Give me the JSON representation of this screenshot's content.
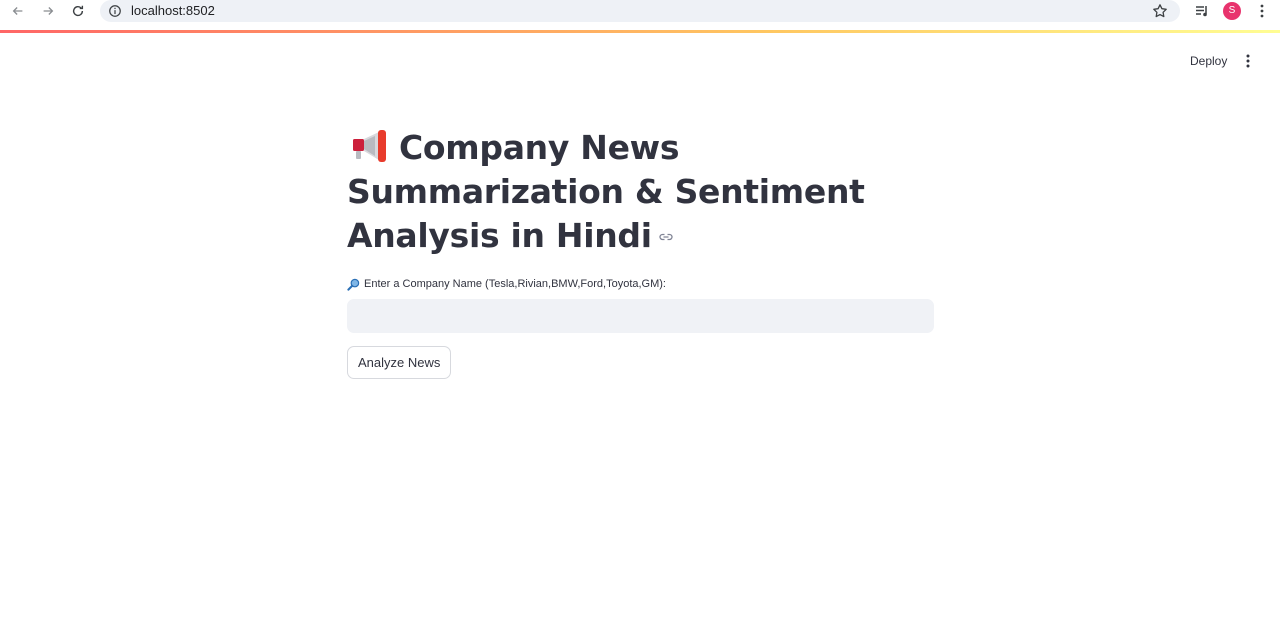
{
  "browser": {
    "url": "localhost:8502",
    "profile_initial": "S",
    "profile_color": "#e8336d"
  },
  "toolbar": {
    "deploy_label": "Deploy"
  },
  "main": {
    "title": "Company News Summarization & Sentiment Analysis in Hindi",
    "input_label": "Enter a Company Name (Tesla,Rivian,BMW,Ford,Toyota,GM):",
    "input_value": "",
    "button_label": "Analyze News"
  },
  "icons": {
    "title_icon": "megaphone-icon",
    "label_icon": "magnifier-icon",
    "anchor_icon": "link-icon"
  },
  "colors": {
    "text": "#31333f",
    "input_bg": "#f0f2f6",
    "accent": "#ff4b4b"
  }
}
